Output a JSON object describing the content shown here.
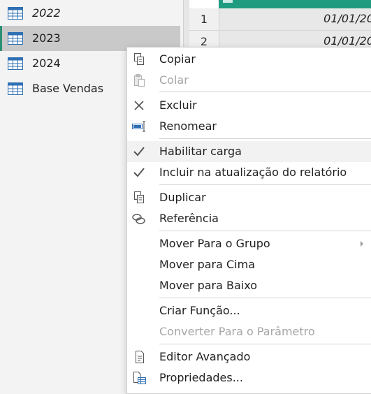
{
  "queries": [
    {
      "label": "2022",
      "italic": true,
      "selected": false,
      "icon": "table-icon"
    },
    {
      "label": "2023",
      "italic": false,
      "selected": true,
      "icon": "table-icon"
    },
    {
      "label": "2024",
      "italic": false,
      "selected": false,
      "icon": "table-icon"
    },
    {
      "label": "Base Vendas",
      "italic": false,
      "selected": false,
      "icon": "table-icon"
    }
  ],
  "grid": {
    "rows": [
      {
        "num": "1",
        "value": "01/01/20"
      },
      {
        "num": "2",
        "value": "01/01/20"
      }
    ]
  },
  "context_menu": {
    "items": [
      {
        "label": "Copiar",
        "icon": "copy-icon",
        "disabled": false
      },
      {
        "label": "Colar",
        "icon": "paste-icon",
        "disabled": true
      },
      {
        "label": "Excluir",
        "icon": "delete-x-icon",
        "disabled": false
      },
      {
        "label": "Renomear",
        "icon": "rename-icon",
        "disabled": false
      },
      {
        "label": "Habilitar carga",
        "icon": "checkmark-icon",
        "disabled": false
      },
      {
        "label": "Incluir na atualização do relatório",
        "icon": "checkmark-icon",
        "disabled": false
      },
      {
        "label": "Duplicar",
        "icon": "duplicate-icon",
        "disabled": false
      },
      {
        "label": "Referência",
        "icon": "reference-link-icon",
        "disabled": false
      },
      {
        "label": "Mover Para o Grupo",
        "icon": "",
        "disabled": false,
        "submenu": true
      },
      {
        "label": "Mover para Cima",
        "icon": "",
        "disabled": false
      },
      {
        "label": "Mover para Baixo",
        "icon": "",
        "disabled": false
      },
      {
        "label": "Criar Função...",
        "icon": "",
        "disabled": false
      },
      {
        "label": "Converter Para o Parâmetro",
        "icon": "",
        "disabled": true
      },
      {
        "label": "Editor Avançado",
        "icon": "advanced-editor-icon",
        "disabled": false
      },
      {
        "label": "Propriedades...",
        "icon": "properties-icon",
        "disabled": false
      }
    ]
  },
  "colors": {
    "selection_accent": "#2b8f74",
    "grid_header": "#1f9c7f",
    "table_icon_blue": "#2f6fb3",
    "disabled_text": "#a6a6a6"
  }
}
